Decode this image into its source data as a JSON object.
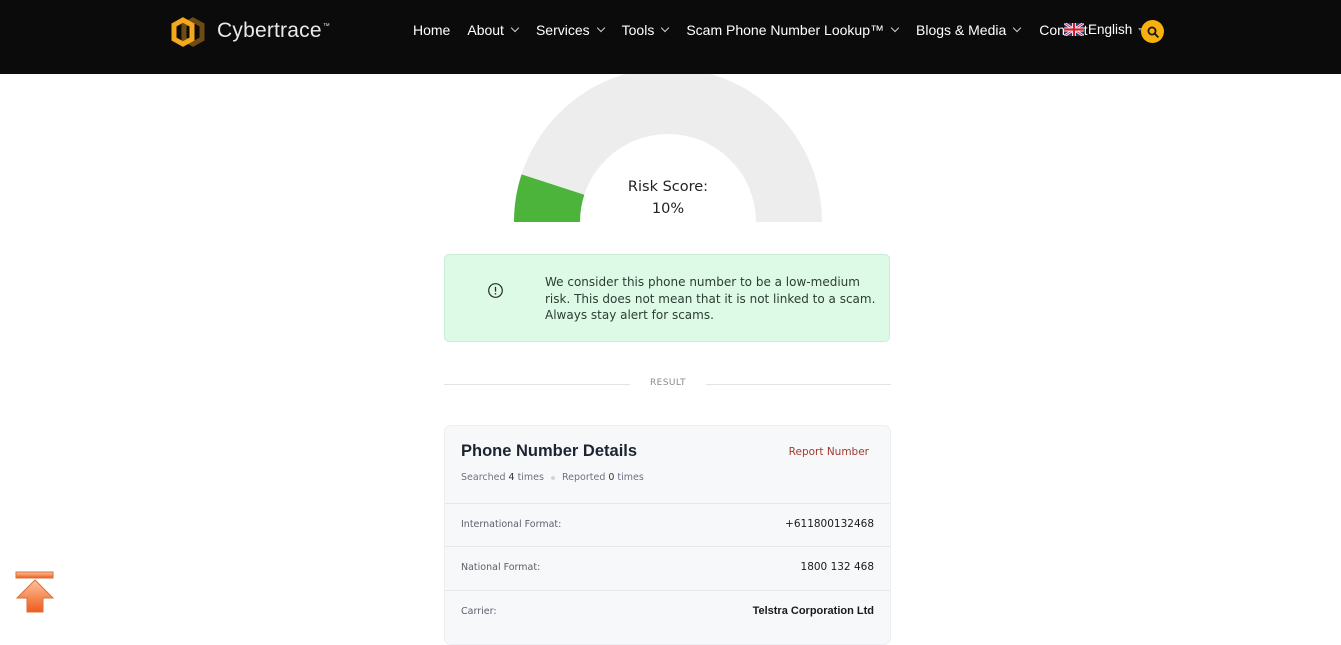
{
  "header": {
    "brand": "Cybertrace",
    "brand_tm": "™",
    "nav": [
      {
        "label": "Home",
        "has_dropdown": false
      },
      {
        "label": "About",
        "has_dropdown": true
      },
      {
        "label": "Services",
        "has_dropdown": true
      },
      {
        "label": "Tools",
        "has_dropdown": true
      },
      {
        "label": "Scam Phone Number Lookup™",
        "has_dropdown": true
      },
      {
        "label": "Blogs & Media",
        "has_dropdown": true
      },
      {
        "label": "Contact",
        "has_dropdown": false
      }
    ],
    "language": {
      "label": "English",
      "flag_icon": "uk-flag-icon"
    },
    "search_icon": "search-icon",
    "colors": {
      "background": "#0b0b0c",
      "accent": "#f6b10f"
    }
  },
  "gauge": {
    "label": "Risk Score:",
    "value_text": "10%",
    "value_fraction": 0.1,
    "colors": {
      "fill": "#4cb43a",
      "track": "#ededed"
    }
  },
  "alert": {
    "icon": "exclamation-circle-icon",
    "text": "We consider this phone number to be a low-medium risk. This does not mean that it is not linked to a scam. Always stay alert for scams.",
    "colors": {
      "background": "#dcfae6"
    }
  },
  "divider": {
    "label": "RESULT"
  },
  "details": {
    "title": "Phone Number Details",
    "report_label": "Report Number",
    "searched_prefix": "Searched",
    "searched_count": "4",
    "searched_suffix": "times",
    "reported_prefix": "Reported",
    "reported_count": "0",
    "reported_suffix": "times",
    "rows": [
      {
        "label": "International Format:",
        "value": "+611800132468"
      },
      {
        "label": "National Format:",
        "value": "1800 132 468"
      },
      {
        "label": "Carrier:",
        "value": "Telstra Corporation Ltd"
      }
    ]
  },
  "scroll_top": {
    "icon": "scroll-to-top-arrow-icon"
  }
}
